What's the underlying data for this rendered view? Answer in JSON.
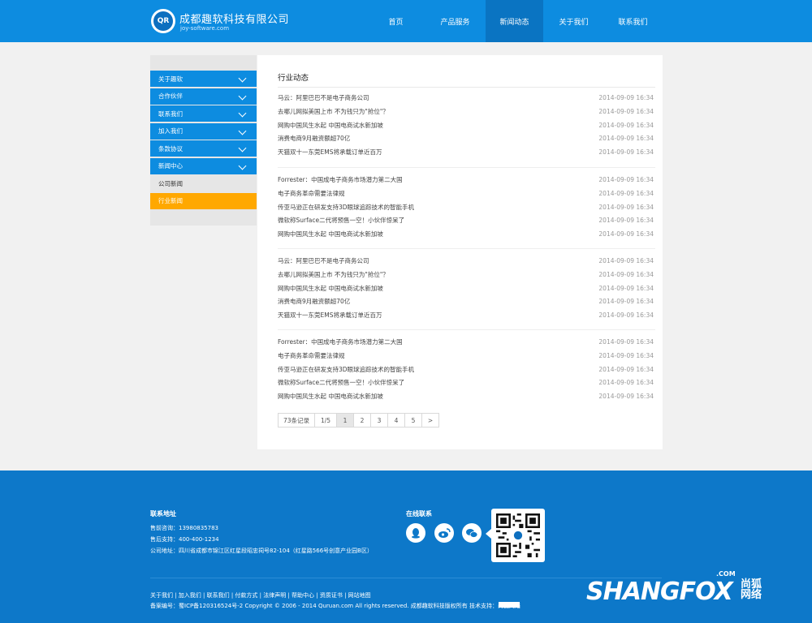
{
  "header": {
    "logo_text": "QR",
    "company_name": "成都趣软科技有限公司",
    "domain": "joy-software.com",
    "nav": [
      {
        "label": "首页"
      },
      {
        "label": "产品服务"
      },
      {
        "label": "新闻动态",
        "active": true
      },
      {
        "label": "关于我们"
      },
      {
        "label": "联系我们"
      }
    ]
  },
  "sidebar": {
    "items": [
      {
        "label": "关于趣软"
      },
      {
        "label": "合作伙伴"
      },
      {
        "label": "联系我们"
      },
      {
        "label": "加入我们"
      },
      {
        "label": "条款协议"
      },
      {
        "label": "新闻中心"
      }
    ],
    "subitems": [
      {
        "label": "公司新闻"
      },
      {
        "label": "行业新闻",
        "active": true
      }
    ],
    "accent": "#0d8ce0",
    "active_color": "#ffa800"
  },
  "main": {
    "title": "行业动态",
    "groups": [
      [
        {
          "title": "马云：阿里巴巴不是电子商务公司",
          "date": "2014-09-09 16:34"
        },
        {
          "title": "去哪儿网拟美国上市 不为钱只为\"抢位\"？",
          "date": "2014-09-09 16:34"
        },
        {
          "title": "网购中国风生水起 中国电商试水新加坡",
          "date": "2014-09-09 16:34"
        },
        {
          "title": "消费电商9月融资额超70亿",
          "date": "2014-09-09 16:34"
        },
        {
          "title": "天猫双十一东莞EMS将承载订单近百万",
          "date": "2014-09-09 16:34"
        }
      ],
      [
        {
          "title": "Forrester：中国成电子商务市场潜力第二大国",
          "date": "2014-09-09 16:34"
        },
        {
          "title": "电子商务革命需要法律规",
          "date": "2014-09-09 16:34"
        },
        {
          "title": "传亚马逊正在研发支持3D眼球追踪技术的智能手机",
          "date": "2014-09-09 16:34"
        },
        {
          "title": "微软称Surface二代将预售一空！小伙伴惊呆了",
          "date": "2014-09-09 16:34"
        },
        {
          "title": "网购中国风生水起 中国电商试水新加坡",
          "date": "2014-09-09 16:34"
        }
      ],
      [
        {
          "title": "马云：阿里巴巴不是电子商务公司",
          "date": "2014-09-09 16:34"
        },
        {
          "title": "去哪儿网拟美国上市 不为钱只为\"抢位\"？",
          "date": "2014-09-09 16:34"
        },
        {
          "title": "网购中国风生水起 中国电商试水新加坡",
          "date": "2014-09-09 16:34"
        },
        {
          "title": "消费电商9月融资额超70亿",
          "date": "2014-09-09 16:34"
        },
        {
          "title": "天猫双十一东莞EMS将承载订单近百万",
          "date": "2014-09-09 16:34"
        }
      ],
      [
        {
          "title": "Forrester：中国成电子商务市场潜力第二大国",
          "date": "2014-09-09 16:34"
        },
        {
          "title": "电子商务革命需要法律规",
          "date": "2014-09-09 16:34"
        },
        {
          "title": "传亚马逊正在研发支持3D眼球追踪技术的智能手机",
          "date": "2014-09-09 16:34"
        },
        {
          "title": "微软称Surface二代将预售一空！小伙伴惊呆了",
          "date": "2014-09-09 16:34"
        },
        {
          "title": "网购中国风生水起 中国电商试水新加坡",
          "date": "2014-09-09 16:34"
        }
      ]
    ],
    "pager": {
      "total": "73条记录",
      "pages_label": "1/5",
      "pages": [
        "1",
        "2",
        "3",
        "4",
        "5"
      ],
      "current": "1",
      "next": ">"
    }
  },
  "footer": {
    "contact_title": "联系地址",
    "presales": "售前咨询：13980835783",
    "aftersales": "售后支持：400-400-1234",
    "address": "公司地址：四川省成都市锦江区红星段昭忠祠号82-104（红星路566号创意产业园B区）",
    "online_title": "在线联系",
    "social": [
      {
        "icon": "qq-icon"
      },
      {
        "icon": "weibo-icon"
      },
      {
        "icon": "wechat-icon"
      }
    ],
    "links_line": "关于我们 | 加入我们 | 联系我们 | 付款方式 | 法律声明 | 帮助中心 | 资质证书 | 网站地图",
    "copyright_line": "备案编号：蜀ICP备120316524号-2 Copyright © 2006 - 2014 Quruan.com All rights reserved. 成都趣软科技版权所有 技术支持：尚狐网络",
    "brand": "SHANGFOX",
    "brand_com": ".COM",
    "brand_cn": "尚狐网络",
    "bg": "#0d78c9"
  }
}
